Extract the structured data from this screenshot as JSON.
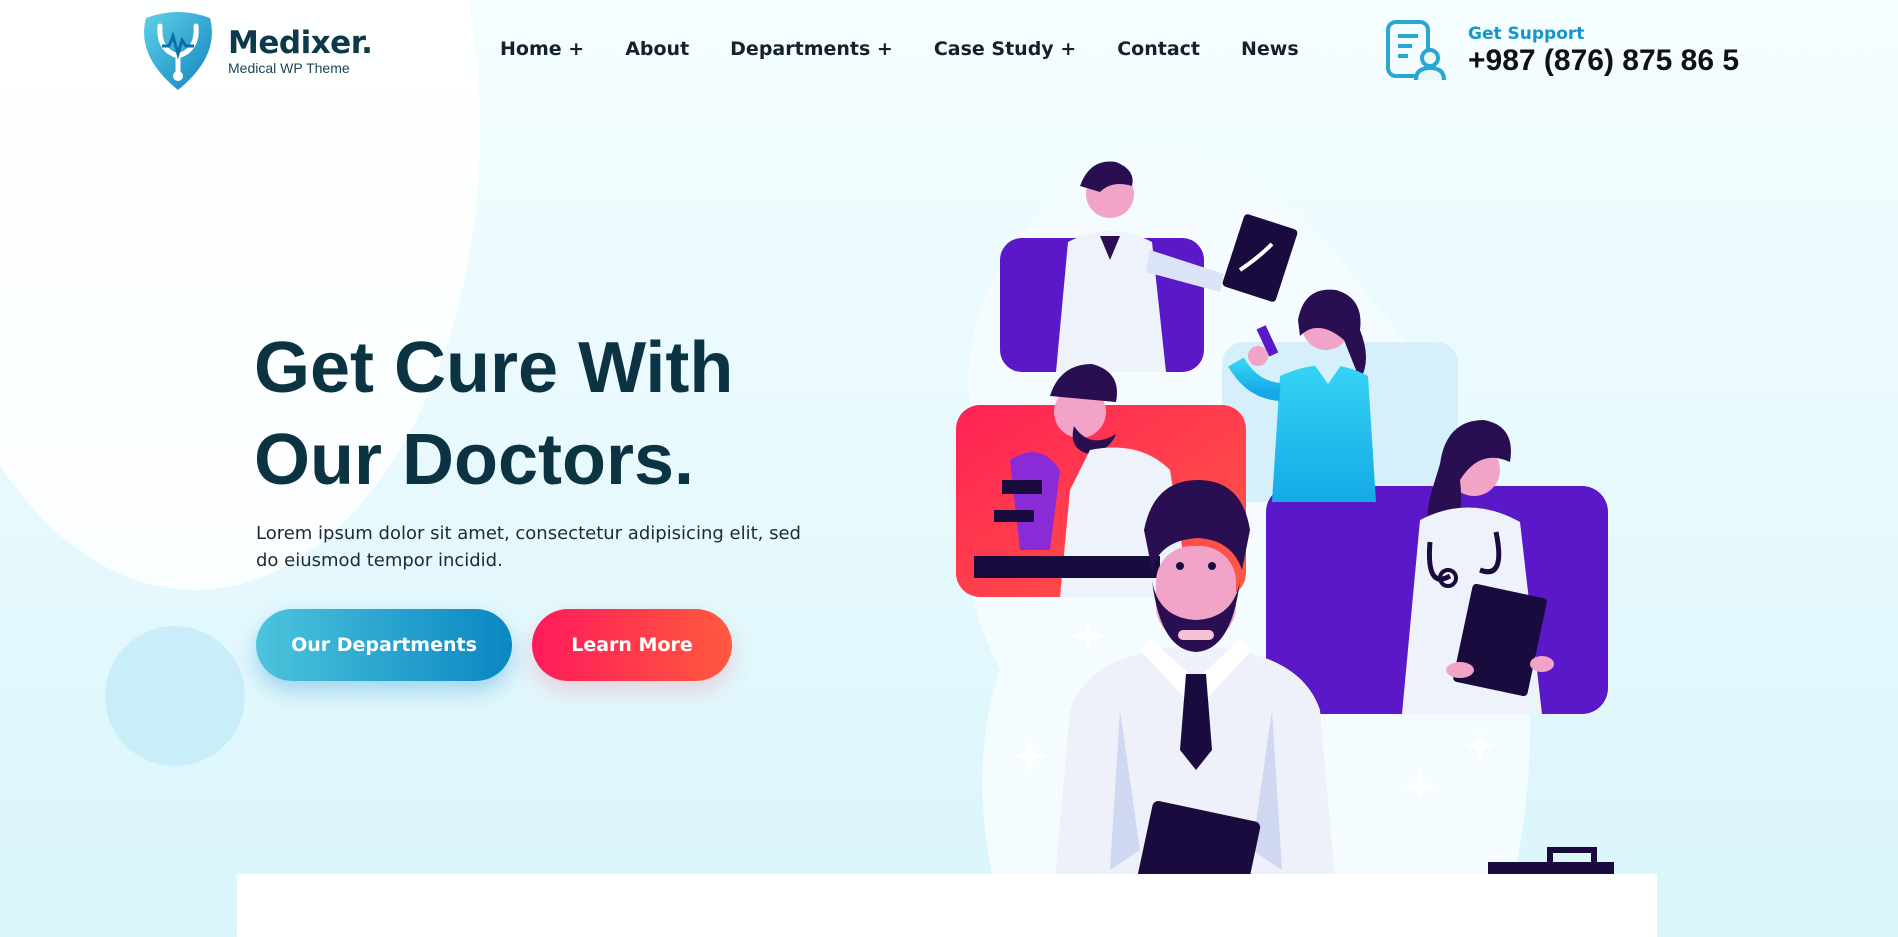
{
  "logo": {
    "title": "Medixer.",
    "subtitle": "Medical WP Theme",
    "icon": "stethoscope-shield-icon"
  },
  "nav": {
    "items": [
      {
        "label": "Home +"
      },
      {
        "label": "About"
      },
      {
        "label": "Departments +"
      },
      {
        "label": "Case Study +"
      },
      {
        "label": "Contact"
      },
      {
        "label": "News"
      }
    ]
  },
  "support": {
    "label": "Get Support",
    "phone": "+987 (876) 875 86 5",
    "icon": "support-document-user-icon"
  },
  "hero": {
    "title_line1": "Get Cure With",
    "title_line2": "Our Doctors.",
    "description": "Lorem ipsum dolor sit amet, consectetur adipisicing elit, sed do eiusmod tempor incidid.",
    "primary_button": "Our Departments",
    "secondary_button": "Learn More"
  },
  "colors": {
    "brand_blue": "#1596c8",
    "title_dark": "#0b3342",
    "accent_red": "#ff1a5b",
    "accent_purple": "#5a18c9"
  }
}
